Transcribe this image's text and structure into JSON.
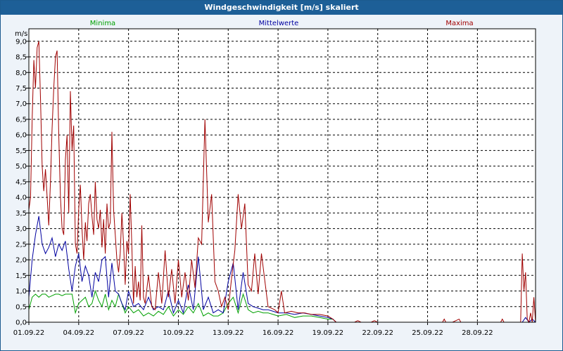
{
  "chart_data": {
    "type": "line",
    "title": "Windgeschwindigkeit [m/s] skaliert",
    "ylabel": "m/s",
    "xlabel": "",
    "ylim": [
      0,
      9.4
    ],
    "xlim": [
      0,
      30.5
    ],
    "grid": true,
    "legend_placement": "top",
    "y_ticks": [
      "0,0",
      "0,5",
      "1,0",
      "1,5",
      "2,0",
      "2,5",
      "3,0",
      "3,5",
      "4,0",
      "4,5",
      "5,0",
      "5,5",
      "6,0",
      "6,5",
      "7,0",
      "7,5",
      "8,0",
      "8,5",
      "9,0"
    ],
    "x_ticks": [
      "01.09.22",
      "04.09.22",
      "07.09.22",
      "10.09.22",
      "13.09.22",
      "16.09.22",
      "19.09.22",
      "22.09.22",
      "25.09.22",
      "28.09.22"
    ],
    "x_tick_days": [
      0,
      3,
      6,
      9,
      12,
      15,
      18,
      21,
      24,
      27
    ],
    "series": [
      {
        "name": "Minima",
        "color": "#00a000",
        "x": [
          0,
          0.2,
          0.4,
          0.6,
          0.8,
          1.0,
          1.2,
          1.4,
          1.6,
          1.8,
          2.0,
          2.2,
          2.4,
          2.6,
          2.8,
          3.0,
          3.2,
          3.4,
          3.6,
          3.8,
          4.0,
          4.2,
          4.4,
          4.6,
          4.8,
          5.0,
          5.2,
          5.4,
          5.6,
          5.8,
          6.0,
          6.3,
          6.6,
          6.9,
          7.2,
          7.5,
          7.8,
          8.1,
          8.4,
          8.7,
          9.0,
          9.3,
          9.6,
          9.9,
          10.2,
          10.5,
          10.8,
          11.1,
          11.4,
          11.7,
          12.0,
          12.3,
          12.6,
          12.9,
          13.2,
          13.5,
          13.8,
          14.1,
          14.4,
          14.7,
          15.0,
          15.5,
          16.0,
          16.5,
          17.0,
          17.5,
          18.0,
          18.3,
          18.5,
          19.0,
          20.0,
          21.0,
          22.0,
          23.0,
          24.0,
          25.0,
          26.0,
          27.0,
          28.0,
          29.0,
          29.5,
          29.9,
          30.2,
          30.5
        ],
        "values": [
          0.4,
          0.8,
          0.9,
          0.8,
          0.9,
          0.9,
          0.8,
          0.85,
          0.9,
          0.9,
          0.85,
          0.9,
          0.9,
          0.9,
          0.3,
          0.6,
          0.7,
          0.8,
          0.5,
          0.6,
          1.0,
          0.7,
          0.5,
          0.9,
          0.4,
          0.7,
          0.5,
          0.9,
          0.6,
          0.3,
          0.5,
          0.3,
          0.4,
          0.2,
          0.3,
          0.2,
          0.35,
          0.25,
          0.5,
          0.2,
          0.4,
          0.25,
          0.5,
          0.3,
          0.6,
          0.2,
          0.3,
          0.2,
          0.2,
          0.3,
          0.6,
          0.8,
          0.3,
          0.9,
          0.4,
          0.3,
          0.35,
          0.3,
          0.3,
          0.25,
          0.2,
          0.25,
          0.15,
          0.2,
          0.2,
          0.15,
          0.1,
          0.1,
          0.0,
          0.0,
          0.0,
          0.0,
          0.0,
          0.0,
          0.0,
          0.0,
          0.0,
          0.0,
          0.0,
          0.0,
          0.0,
          0.0,
          0.0,
          0.0
        ]
      },
      {
        "name": "Mittelwerte",
        "color": "#0000a0",
        "x": [
          0,
          0.2,
          0.4,
          0.6,
          0.8,
          1.0,
          1.2,
          1.4,
          1.6,
          1.8,
          2.0,
          2.2,
          2.4,
          2.6,
          2.8,
          3.0,
          3.2,
          3.4,
          3.6,
          3.8,
          4.0,
          4.2,
          4.4,
          4.6,
          4.8,
          5.0,
          5.2,
          5.4,
          5.6,
          5.8,
          6.0,
          6.3,
          6.6,
          6.9,
          7.2,
          7.5,
          7.8,
          8.1,
          8.4,
          8.7,
          9.0,
          9.3,
          9.6,
          9.9,
          10.2,
          10.5,
          10.8,
          11.1,
          11.4,
          11.7,
          12.0,
          12.3,
          12.6,
          12.9,
          13.2,
          13.5,
          13.8,
          14.1,
          14.4,
          14.7,
          15.0,
          15.5,
          16.0,
          16.5,
          17.0,
          17.5,
          18.0,
          18.3,
          18.5,
          19.0,
          20.0,
          21.0,
          22.0,
          23.0,
          24.0,
          25.0,
          26.0,
          27.0,
          28.0,
          29.0,
          29.5,
          29.7,
          29.9,
          30.1,
          30.3,
          30.5
        ],
        "values": [
          0.8,
          2.0,
          2.8,
          3.4,
          2.5,
          2.2,
          2.4,
          2.7,
          2.1,
          2.5,
          2.3,
          2.6,
          1.7,
          1.0,
          1.8,
          2.2,
          1.3,
          1.8,
          1.5,
          0.8,
          1.6,
          1.3,
          2.0,
          2.1,
          0.8,
          1.9,
          1.0,
          0.9,
          0.6,
          0.4,
          1.0,
          0.5,
          0.6,
          0.4,
          0.8,
          0.4,
          0.5,
          0.4,
          1.0,
          0.3,
          0.7,
          0.3,
          1.2,
          0.4,
          2.1,
          0.4,
          0.8,
          0.3,
          0.4,
          0.3,
          1.3,
          1.9,
          0.4,
          1.6,
          0.6,
          0.5,
          0.45,
          0.4,
          0.4,
          0.35,
          0.3,
          0.3,
          0.25,
          0.3,
          0.25,
          0.2,
          0.15,
          0.1,
          0.0,
          0.0,
          0.0,
          0.0,
          0.0,
          0.0,
          0.0,
          0.0,
          0.0,
          0.0,
          0.0,
          0.0,
          0.0,
          0.0,
          0.15,
          0.0,
          0.1,
          0.0
        ]
      },
      {
        "name": "Maxima",
        "color": "#a00000",
        "x": [
          0,
          0.1,
          0.2,
          0.3,
          0.4,
          0.5,
          0.6,
          0.7,
          0.8,
          0.9,
          1.0,
          1.1,
          1.2,
          1.3,
          1.4,
          1.5,
          1.6,
          1.7,
          1.8,
          1.9,
          2.0,
          2.1,
          2.2,
          2.3,
          2.4,
          2.5,
          2.6,
          2.7,
          2.8,
          2.9,
          3.0,
          3.1,
          3.2,
          3.3,
          3.4,
          3.5,
          3.6,
          3.7,
          3.8,
          3.9,
          4.0,
          4.1,
          4.2,
          4.3,
          4.4,
          4.5,
          4.6,
          4.7,
          4.8,
          4.9,
          5.0,
          5.1,
          5.2,
          5.3,
          5.4,
          5.5,
          5.6,
          5.7,
          5.8,
          5.9,
          6.0,
          6.1,
          6.2,
          6.3,
          6.4,
          6.5,
          6.6,
          6.7,
          6.8,
          6.9,
          7.0,
          7.2,
          7.4,
          7.6,
          7.8,
          8.0,
          8.2,
          8.4,
          8.6,
          8.8,
          9.0,
          9.2,
          9.4,
          9.6,
          9.8,
          10.0,
          10.2,
          10.4,
          10.6,
          10.8,
          11.0,
          11.2,
          11.4,
          11.6,
          11.8,
          12.0,
          12.2,
          12.4,
          12.6,
          12.8,
          13.0,
          13.2,
          13.4,
          13.6,
          13.8,
          14.0,
          14.4,
          14.8,
          15.0,
          15.2,
          15.4,
          15.8,
          16.2,
          16.6,
          17.0,
          17.5,
          18.0,
          18.3,
          18.5,
          19.0,
          19.6,
          19.8,
          20.0,
          20.6,
          20.8,
          21.0,
          22.0,
          23.0,
          24.0,
          24.9,
          25.0,
          25.1,
          25.5,
          25.9,
          26.0,
          26.1,
          27.0,
          28.4,
          28.5,
          28.6,
          29.0,
          29.4,
          29.6,
          29.7,
          29.8,
          29.9,
          30.0,
          30.1,
          30.2,
          30.3,
          30.4,
          30.5
        ],
        "values": [
          3.6,
          4.0,
          6.5,
          8.4,
          7.5,
          8.8,
          9.0,
          7.2,
          5.0,
          4.2,
          4.9,
          4.0,
          3.1,
          4.5,
          6.2,
          7.5,
          8.5,
          8.7,
          6.0,
          4.0,
          3.0,
          2.8,
          5.2,
          6.0,
          3.5,
          7.4,
          5.5,
          6.3,
          2.5,
          2.2,
          3.6,
          4.4,
          3.0,
          2.0,
          3.2,
          2.6,
          3.8,
          4.1,
          3.4,
          2.8,
          4.5,
          3.3,
          3.0,
          3.6,
          2.4,
          3.3,
          2.2,
          3.8,
          3.0,
          3.2,
          6.1,
          3.6,
          2.8,
          2.0,
          1.6,
          2.2,
          3.5,
          2.5,
          1.2,
          2.6,
          2.2,
          4.1,
          2.4,
          0.6,
          1.8,
          0.8,
          1.3,
          0.7,
          3.1,
          0.8,
          0.6,
          1.5,
          0.5,
          0.4,
          1.6,
          0.6,
          2.3,
          0.8,
          1.7,
          0.6,
          2.0,
          0.8,
          1.6,
          0.7,
          2.0,
          1.1,
          2.7,
          2.5,
          6.5,
          3.2,
          4.1,
          1.3,
          1.0,
          0.5,
          0.8,
          0.4,
          1.4,
          2.3,
          4.1,
          3.0,
          3.8,
          1.2,
          1.0,
          2.2,
          0.9,
          2.2,
          0.5,
          0.4,
          0.3,
          1.0,
          0.3,
          0.35,
          0.3,
          0.3,
          0.25,
          0.25,
          0.2,
          0.1,
          0.0,
          0.0,
          0.0,
          0.05,
          0.0,
          0.0,
          0.05,
          0.0,
          0.0,
          0.0,
          0.0,
          0.0,
          0.1,
          0.0,
          0.0,
          0.1,
          0.0,
          0.0,
          0.0,
          0.0,
          0.1,
          0.0,
          0.0,
          0.0,
          0.0,
          2.2,
          1.0,
          1.6,
          0.1,
          0.0,
          0.3,
          0.0,
          0.8,
          0.0
        ]
      }
    ]
  }
}
